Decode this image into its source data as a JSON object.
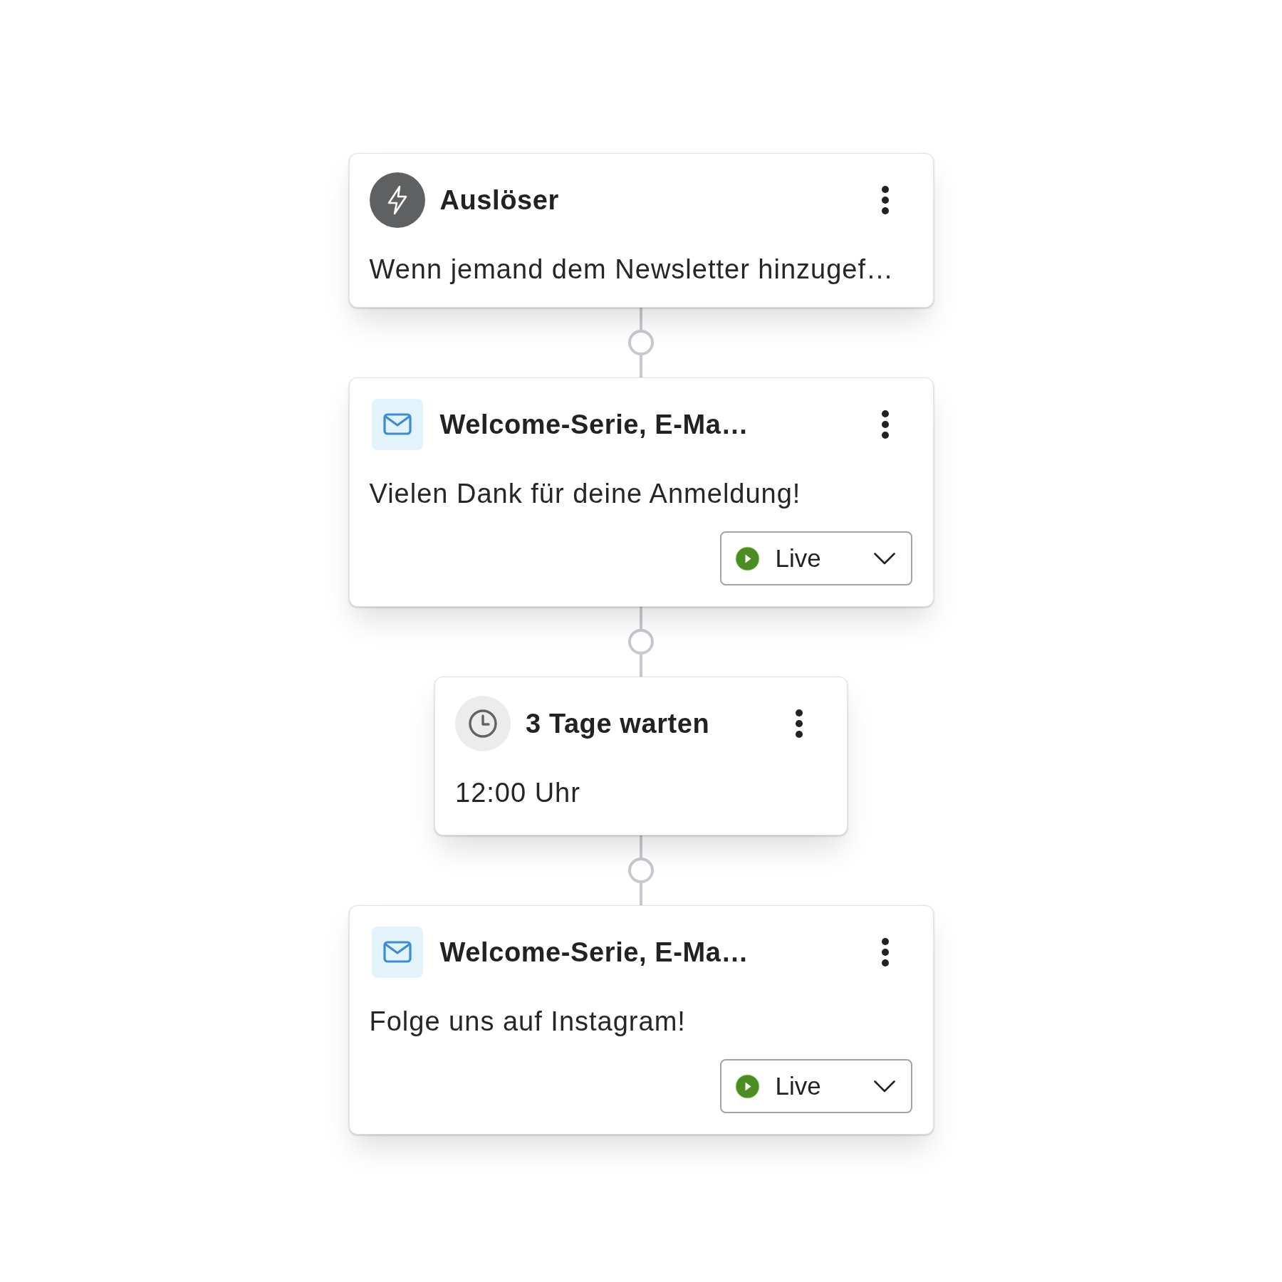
{
  "steps": [
    {
      "kind": "trigger",
      "title": "Auslöser",
      "description": "Wenn jemand dem Newsletter hinzugef…"
    },
    {
      "kind": "email",
      "title": "Welcome-Serie, E-Ma…",
      "description": "Vielen Dank für deine Anmeldung!",
      "status": {
        "label": "Live"
      }
    },
    {
      "kind": "delay",
      "title": "3 Tage warten",
      "description": "12:00 Uhr"
    },
    {
      "kind": "email",
      "title": "Welcome-Serie, E-Ma…",
      "description": "Folge uns auf Instagram!",
      "status": {
        "label": "Live"
      }
    }
  ]
}
